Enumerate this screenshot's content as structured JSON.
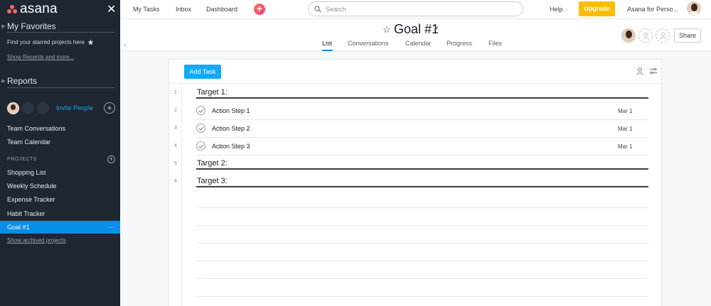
{
  "sidebar": {
    "logo_text": "asana",
    "close_icon": "close-icon",
    "favorites": {
      "heading": "My Favorites",
      "hint": "Find your starred projects here",
      "recents_link": "Show Recents and more..."
    },
    "reports": {
      "heading": "Reports"
    },
    "team": {
      "invite_label": "Invite People"
    },
    "team_links": [
      "Team Conversations",
      "Team Calendar"
    ],
    "projects_heading": "PROJECTS",
    "projects": [
      "Shopping List",
      "Weekly Schedule",
      "Expense Tracker",
      "Habit Tracker",
      "Goal #1"
    ],
    "active_project_more": "···",
    "archived_link": "Show archived projects"
  },
  "topbar": {
    "nav": [
      "My Tasks",
      "Inbox",
      "Dashboard"
    ],
    "quick_add": "+",
    "search_placeholder": "Search",
    "help": "Help",
    "upgrade": "Upgrade",
    "workspace": "Asana for Perso..."
  },
  "project": {
    "title": "Goal #1",
    "tabs": [
      "List",
      "Conversations",
      "Calendar",
      "Progress",
      "Files"
    ],
    "active_tab": "List",
    "share": "Share"
  },
  "list": {
    "add_task": "Add Task",
    "rows": [
      {
        "num": "1",
        "kind": "section",
        "name": "Target 1:"
      },
      {
        "num": "2",
        "kind": "task",
        "name": "Action Step 1",
        "due": "Mar 1"
      },
      {
        "num": "3",
        "kind": "task",
        "name": "Action Step 2",
        "due": "Mar 1"
      },
      {
        "num": "4",
        "kind": "task",
        "name": "Action Step 3",
        "due": "Mar 1"
      },
      {
        "num": "5",
        "kind": "section",
        "name": "Target 2:"
      },
      {
        "num": "6",
        "kind": "section",
        "name": "Target 3:"
      }
    ]
  },
  "colors": {
    "sidebar_bg": "#1f2733",
    "accent_blue": "#0a8fe8",
    "add_task_blue": "#14aaf5",
    "upgrade_yellow": "#fcbd01",
    "logo_coral": "#f06a6a"
  }
}
